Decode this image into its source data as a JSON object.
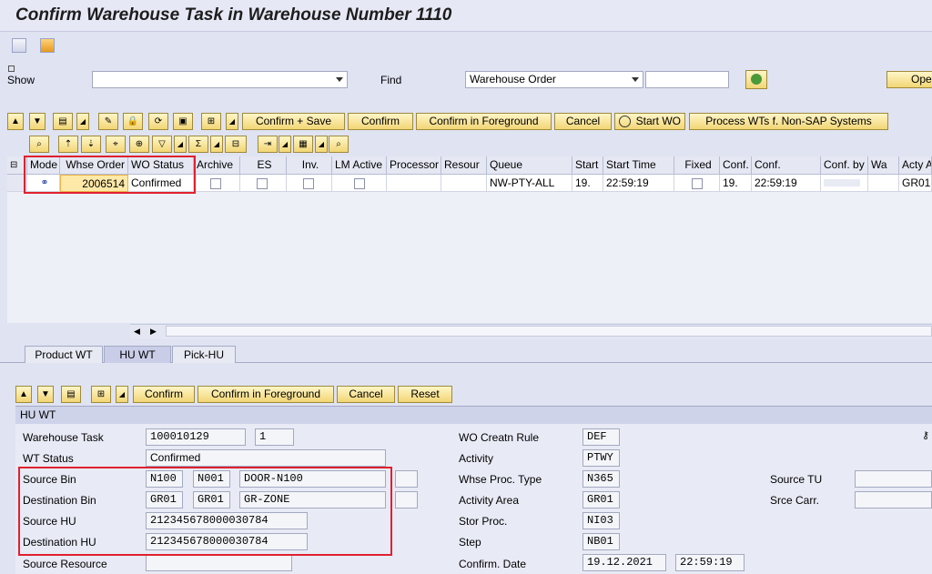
{
  "window": {
    "title": "Confirm Warehouse Task in Warehouse Number 1110"
  },
  "selection": {
    "show_label": "Show",
    "show_value": "",
    "find_label": "Find",
    "find_select": "Warehouse Order",
    "find_value": "",
    "open_label": "Ope"
  },
  "toolbar": {
    "confirm_save": "Confirm + Save",
    "confirm": "Confirm",
    "confirm_foreground": "Confirm in Foreground",
    "cancel": "Cancel",
    "start_wo": "Start WO",
    "process_wts": "Process WTs f. Non-SAP Systems"
  },
  "grid": {
    "columns": [
      "Mode",
      "Whse Order",
      "WO Status",
      "Archive",
      "ES",
      "Inv.",
      "LM Active",
      "Processor",
      "Resour",
      "Queue",
      "Start",
      "Start Time",
      "Fixed",
      "Conf.",
      "Conf.",
      "Conf. by",
      "Wa",
      "Acty A"
    ],
    "row": {
      "whse_order": "2006514",
      "wo_status": "Confirmed",
      "queue": "NW-PTY-ALL",
      "start": "19.",
      "start_time": "22:59:19",
      "conf_date": "19.",
      "conf_time": "22:59:19",
      "acty_area": "GR01"
    }
  },
  "tabs": [
    "Product WT",
    "HU WT",
    "Pick-HU"
  ],
  "detail_toolbar": {
    "confirm": "Confirm",
    "confirm_foreground": "Confirm in Foreground",
    "cancel": "Cancel",
    "reset": "Reset"
  },
  "detail": {
    "section_title": "HU WT",
    "warehouse_task_label": "Warehouse Task",
    "warehouse_task": "100010129",
    "warehouse_task_item": "1",
    "wt_status_label": "WT Status",
    "wt_status": "Confirmed",
    "source_bin_label": "Source Bin",
    "source_bin_type": "N100",
    "source_bin_section": "N001",
    "source_bin": "DOOR-N100",
    "destination_bin_label": "Destination Bin",
    "dest_bin_type": "GR01",
    "dest_bin_section": "GR01",
    "dest_bin": "GR-ZONE",
    "source_hu_label": "Source HU",
    "source_hu": "212345678000030784",
    "destination_hu_label": "Destination HU",
    "destination_hu": "212345678000030784",
    "source_resource_label": "Source Resource",
    "source_resource": "",
    "wo_creatn_rule_label": "WO Creatn Rule",
    "wo_creatn_rule": "DEF",
    "activity_label": "Activity",
    "activity": "PTWY",
    "whse_proc_type_label": "Whse Proc. Type",
    "whse_proc_type": "N365",
    "activity_area_label": "Activity Area",
    "activity_area": "GR01",
    "stor_proc_label": "Stor Proc.",
    "stor_proc": "NI03",
    "step_label": "Step",
    "step": "NB01",
    "confirm_date_label": "Confirm. Date",
    "confirm_date": "19.12.2021",
    "confirm_time": "22:59:19",
    "source_tu_label": "Source TU",
    "source_tu": "",
    "srce_carr_label": "Srce Carr.",
    "srce_carr": ""
  },
  "colors": {
    "highlight": "#e0212e",
    "button": "#f2d675",
    "background": "#dfe3f2"
  }
}
